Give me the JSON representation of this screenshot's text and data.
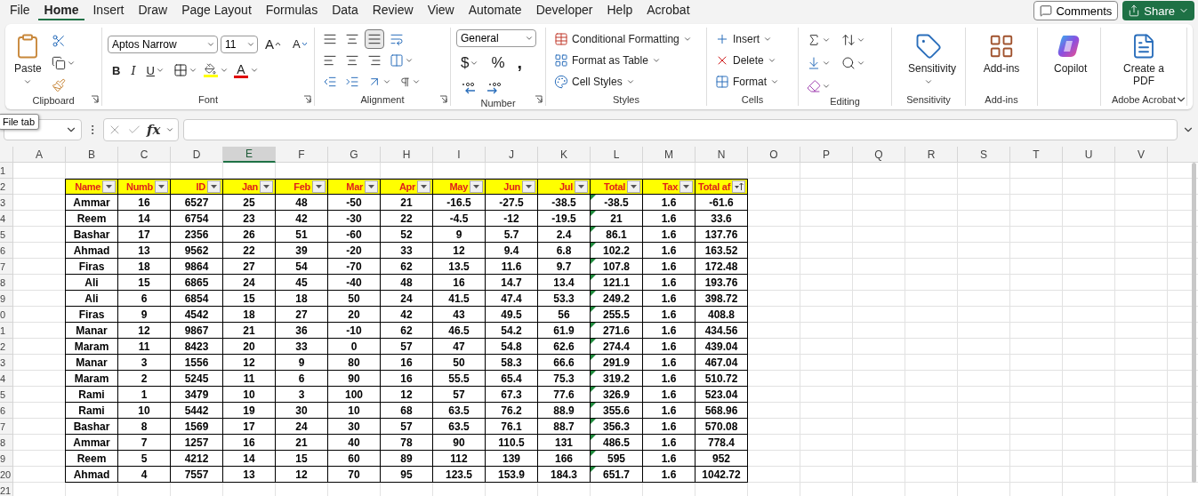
{
  "menu_tabs": [
    {
      "label": "File",
      "selected": false
    },
    {
      "label": "Home",
      "selected": true
    },
    {
      "label": "Insert",
      "selected": false
    },
    {
      "label": "Draw",
      "selected": false
    },
    {
      "label": "Page Layout",
      "selected": false
    },
    {
      "label": "Formulas",
      "selected": false
    },
    {
      "label": "Data",
      "selected": false
    },
    {
      "label": "Review",
      "selected": false
    },
    {
      "label": "View",
      "selected": false
    },
    {
      "label": "Automate",
      "selected": false
    },
    {
      "label": "Developer",
      "selected": false
    },
    {
      "label": "Help",
      "selected": false
    },
    {
      "label": "Acrobat",
      "selected": false
    }
  ],
  "actions": {
    "comments": "Comments",
    "share": "Share"
  },
  "ribbon": {
    "groups": [
      {
        "kind": "clipboard",
        "label": "Clipboard",
        "launcher": true,
        "paste": "Paste"
      },
      {
        "kind": "font",
        "label": "Font",
        "launcher": true,
        "font": "Aptos Narrow",
        "size": "11",
        "grow": "A",
        "shrink": "A",
        "bold": "B",
        "italic": "I",
        "underline": "U",
        "font_color": "A"
      },
      {
        "kind": "alignment",
        "label": "Alignment",
        "launcher": true,
        "vertical_align": [
          {
            "selected": false
          },
          {
            "selected": false
          },
          {
            "selected": true
          }
        ]
      },
      {
        "kind": "number",
        "label": "Number",
        "launcher": true,
        "format": "General",
        "currency": "$",
        "percent": "%",
        "comma": ","
      },
      {
        "kind": "styles",
        "label": "Styles",
        "items": [
          "Conditional Formatting",
          "Format as Table",
          "Cell Styles"
        ]
      },
      {
        "kind": "cells",
        "label": "Cells",
        "items": [
          "Insert",
          "Delete",
          "Format"
        ]
      },
      {
        "kind": "editing",
        "label": "Editing"
      },
      {
        "kind": "sensitivity",
        "label": "Sensitivity",
        "button": "Sensitivity"
      },
      {
        "kind": "addins",
        "label": "Add-ins",
        "button": "Add-ins"
      },
      {
        "kind": "copilot",
        "button": "Copilot"
      },
      {
        "kind": "acrobat",
        "label": "Adobe Acrobat",
        "button": "Create a PDF"
      }
    ]
  },
  "tooltip": "File tab",
  "formula_bar": {
    "fx": "fx"
  },
  "sheet": {
    "columns": [
      {
        "label": "A",
        "selected": false
      },
      {
        "label": "B",
        "selected": false
      },
      {
        "label": "C",
        "selected": false
      },
      {
        "label": "D",
        "selected": false
      },
      {
        "label": "E",
        "selected": true
      },
      {
        "label": "F",
        "selected": false
      },
      {
        "label": "G",
        "selected": false
      },
      {
        "label": "H",
        "selected": false
      },
      {
        "label": "I",
        "selected": false
      },
      {
        "label": "J",
        "selected": false
      },
      {
        "label": "K",
        "selected": false
      },
      {
        "label": "L",
        "selected": false
      },
      {
        "label": "M",
        "selected": false
      },
      {
        "label": "N",
        "selected": false
      },
      {
        "label": "O",
        "selected": false
      },
      {
        "label": "P",
        "selected": false
      },
      {
        "label": "Q",
        "selected": false
      },
      {
        "label": "R",
        "selected": false
      },
      {
        "label": "S",
        "selected": false
      },
      {
        "label": "T",
        "selected": false
      },
      {
        "label": "U",
        "selected": false
      },
      {
        "label": "V",
        "selected": false
      }
    ],
    "rows": [
      "1",
      "2",
      "3",
      "4",
      "5",
      "6",
      "7",
      "8",
      "9",
      "0",
      "1",
      "2",
      "3",
      "4",
      "5",
      "6",
      "7",
      "8",
      "9",
      "20",
      "21"
    ]
  },
  "table": {
    "columns": [
      {
        "label": "Name",
        "sorted": false,
        "error_markers": false
      },
      {
        "label": "Numb",
        "sorted": false,
        "error_markers": false
      },
      {
        "label": "ID",
        "sorted": false,
        "error_markers": false
      },
      {
        "label": "Jan",
        "sorted": false,
        "error_markers": false
      },
      {
        "label": "Feb",
        "sorted": false,
        "error_markers": false
      },
      {
        "label": "Mar",
        "sorted": false,
        "error_markers": false
      },
      {
        "label": "Apr",
        "sorted": false,
        "error_markers": false
      },
      {
        "label": "May",
        "sorted": false,
        "error_markers": false
      },
      {
        "label": "Jun",
        "sorted": false,
        "error_markers": false
      },
      {
        "label": "Jul",
        "sorted": false,
        "error_markers": false
      },
      {
        "label": "Total",
        "sorted": false,
        "error_markers": true
      },
      {
        "label": "Tax",
        "sorted": false,
        "error_markers": false
      },
      {
        "label": "Total af",
        "sorted": true,
        "error_markers": false
      }
    ],
    "rows": [
      [
        "Ammar",
        "16",
        "6527",
        "25",
        "48",
        "-50",
        "21",
        "-16.5",
        "-27.5",
        "-38.5",
        "-38.5",
        "1.6",
        "-61.6"
      ],
      [
        "Reem",
        "14",
        "6754",
        "23",
        "42",
        "-30",
        "22",
        "-4.5",
        "-12",
        "-19.5",
        "21",
        "1.6",
        "33.6"
      ],
      [
        "Bashar",
        "17",
        "2356",
        "26",
        "51",
        "-60",
        "52",
        "9",
        "5.7",
        "2.4",
        "86.1",
        "1.6",
        "137.76"
      ],
      [
        "Ahmad",
        "13",
        "9562",
        "22",
        "39",
        "-20",
        "33",
        "12",
        "9.4",
        "6.8",
        "102.2",
        "1.6",
        "163.52"
      ],
      [
        "Firas",
        "18",
        "9864",
        "27",
        "54",
        "-70",
        "62",
        "13.5",
        "11.6",
        "9.7",
        "107.8",
        "1.6",
        "172.48"
      ],
      [
        "Ali",
        "15",
        "6865",
        "24",
        "45",
        "-40",
        "48",
        "16",
        "14.7",
        "13.4",
        "121.1",
        "1.6",
        "193.76"
      ],
      [
        "Ali",
        "6",
        "6854",
        "15",
        "18",
        "50",
        "24",
        "41.5",
        "47.4",
        "53.3",
        "249.2",
        "1.6",
        "398.72"
      ],
      [
        "Firas",
        "9",
        "4542",
        "18",
        "27",
        "20",
        "42",
        "43",
        "49.5",
        "56",
        "255.5",
        "1.6",
        "408.8"
      ],
      [
        "Manar",
        "12",
        "9867",
        "21",
        "36",
        "-10",
        "62",
        "46.5",
        "54.2",
        "61.9",
        "271.6",
        "1.6",
        "434.56"
      ],
      [
        "Maram",
        "11",
        "8423",
        "20",
        "33",
        "0",
        "57",
        "47",
        "54.8",
        "62.6",
        "274.4",
        "1.6",
        "439.04"
      ],
      [
        "Manar",
        "3",
        "1556",
        "12",
        "9",
        "80",
        "16",
        "50",
        "58.3",
        "66.6",
        "291.9",
        "1.6",
        "467.04"
      ],
      [
        "Maram",
        "2",
        "5245",
        "11",
        "6",
        "90",
        "16",
        "55.5",
        "65.4",
        "75.3",
        "319.2",
        "1.6",
        "510.72"
      ],
      [
        "Rami",
        "1",
        "3479",
        "10",
        "3",
        "100",
        "12",
        "57",
        "67.3",
        "77.6",
        "326.9",
        "1.6",
        "523.04"
      ],
      [
        "Rami",
        "10",
        "5442",
        "19",
        "30",
        "10",
        "68",
        "63.5",
        "76.2",
        "88.9",
        "355.6",
        "1.6",
        "568.96"
      ],
      [
        "Bashar",
        "8",
        "1569",
        "17",
        "24",
        "30",
        "57",
        "63.5",
        "76.1",
        "88.7",
        "356.3",
        "1.6",
        "570.08"
      ],
      [
        "Ammar",
        "7",
        "1257",
        "16",
        "21",
        "40",
        "78",
        "90",
        "110.5",
        "131",
        "486.5",
        "1.6",
        "778.4"
      ],
      [
        "Reem",
        "5",
        "4212",
        "14",
        "15",
        "60",
        "89",
        "112",
        "139",
        "166",
        "595",
        "1.6",
        "952"
      ],
      [
        "Ahmad",
        "4",
        "7557",
        "13",
        "12",
        "70",
        "95",
        "123.5",
        "153.9",
        "184.3",
        "651.7",
        "1.6",
        "1042.72"
      ]
    ]
  }
}
